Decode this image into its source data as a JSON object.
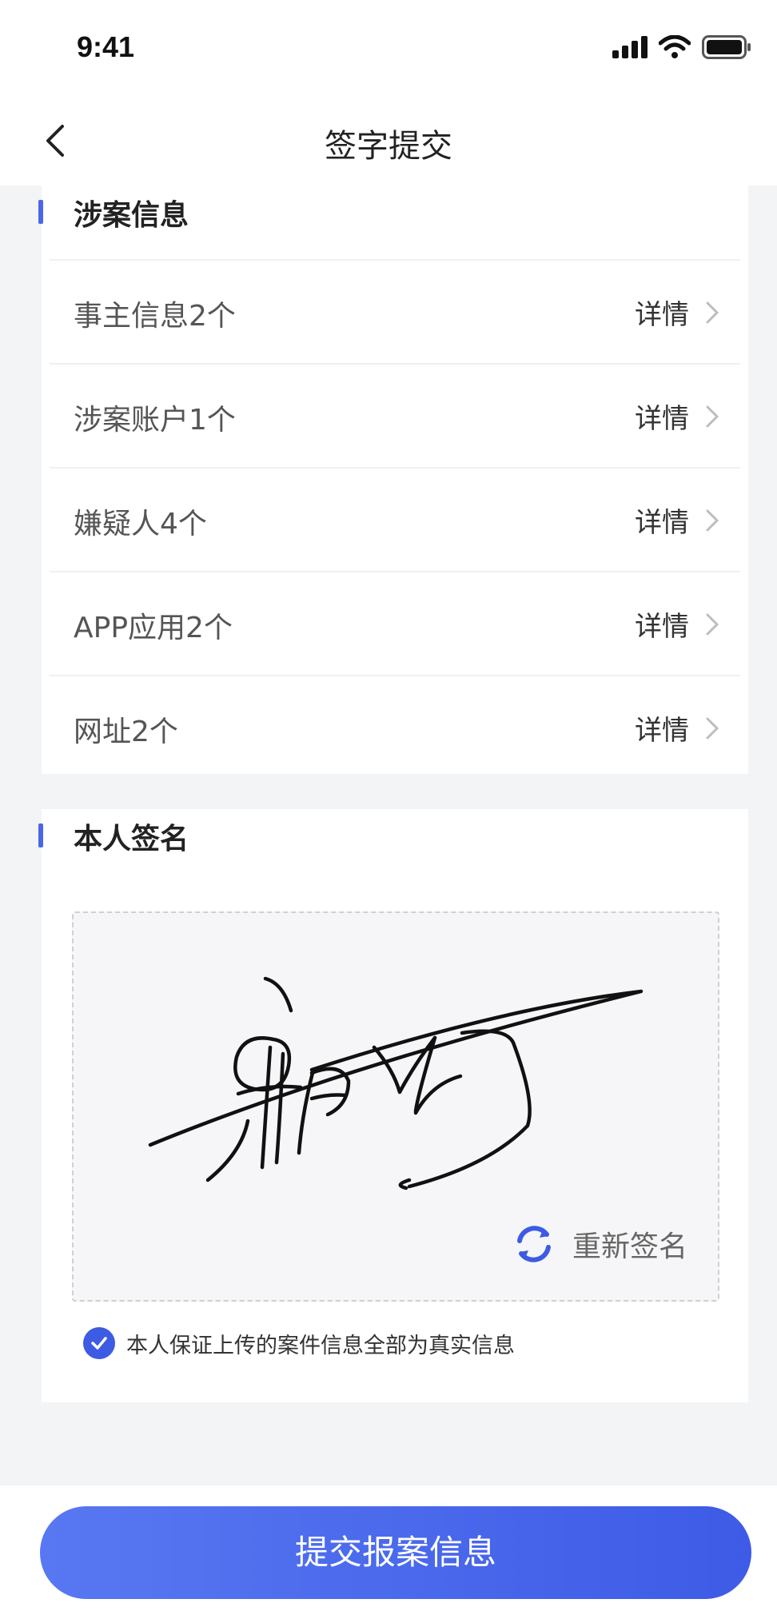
{
  "status_bar": {
    "time": "9:41"
  },
  "header": {
    "title": "签字提交"
  },
  "involved": {
    "title": "涉案信息",
    "detail_label": "详情",
    "rows": [
      {
        "label": "事主信息2个"
      },
      {
        "label": "涉案账户1个"
      },
      {
        "label": "嫌疑人4个"
      },
      {
        "label": "APP应用2个"
      },
      {
        "label": "网址2个"
      }
    ]
  },
  "signature": {
    "title": "本人签名",
    "resign_label": "重新签名",
    "agreement": "本人保证上传的案件信息全部为真实信息",
    "agreement_checked": true
  },
  "footer": {
    "submit_label": "提交报案信息"
  },
  "colors": {
    "accent": "#3d5be3",
    "background": "#f3f4f6"
  }
}
